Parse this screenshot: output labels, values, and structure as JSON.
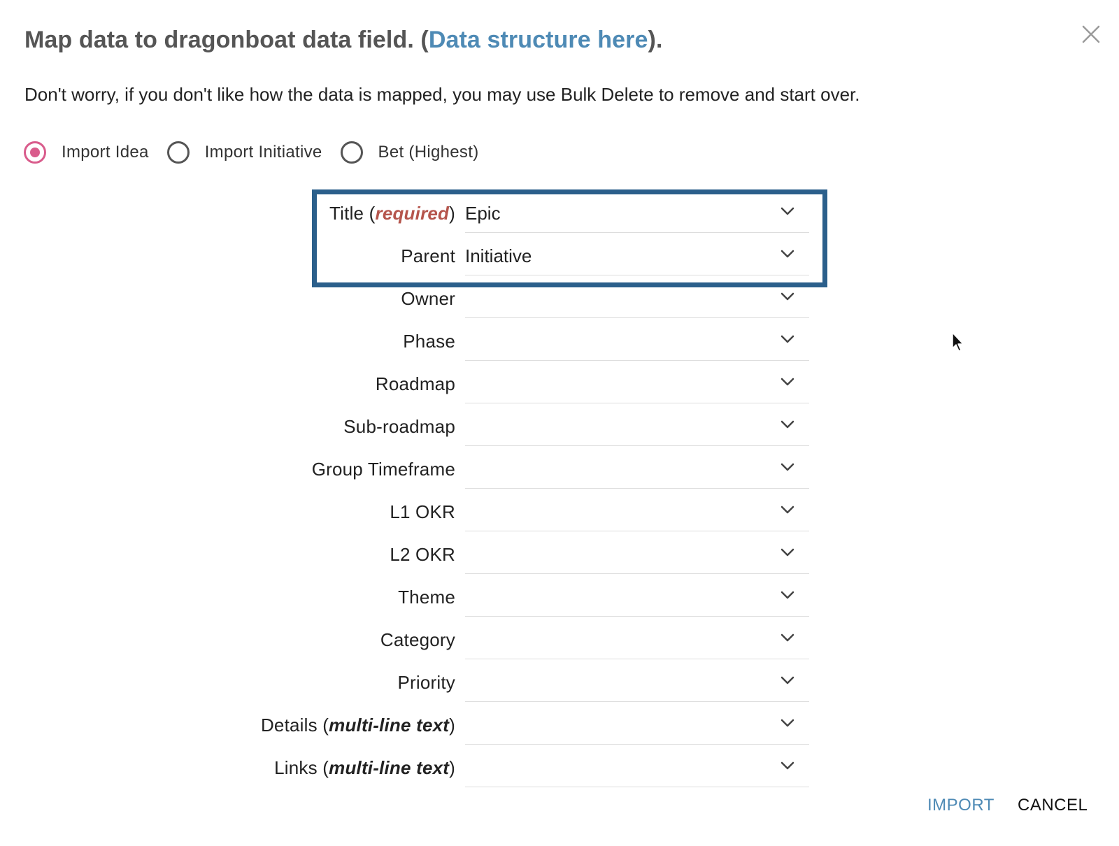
{
  "dialog": {
    "title_prefix": "Map data to dragonboat data field. (",
    "title_link": "Data structure here",
    "title_suffix": ").",
    "subtitle": "Don't worry, if you don't like how the data is mapped, you may use Bulk Delete to remove and start over.",
    "close_icon": "close-icon"
  },
  "import_type": {
    "selected": "Import Idea",
    "options": [
      {
        "label": "Import Idea",
        "checked": true
      },
      {
        "label": "Import Initiative",
        "checked": false
      },
      {
        "label": "Bet (Highest)",
        "checked": false
      }
    ]
  },
  "mappings": [
    {
      "label": "Title",
      "qualifier": "required",
      "value": "Epic"
    },
    {
      "label": "Parent",
      "qualifier": "",
      "value": "Initiative"
    },
    {
      "label": "Owner",
      "qualifier": "",
      "value": ""
    },
    {
      "label": "Phase",
      "qualifier": "",
      "value": ""
    },
    {
      "label": "Roadmap",
      "qualifier": "",
      "value": ""
    },
    {
      "label": "Sub-roadmap",
      "qualifier": "",
      "value": ""
    },
    {
      "label": "Group Timeframe",
      "qualifier": "",
      "value": ""
    },
    {
      "label": "L1 OKR",
      "qualifier": "",
      "value": ""
    },
    {
      "label": "L2 OKR",
      "qualifier": "",
      "value": ""
    },
    {
      "label": "Theme",
      "qualifier": "",
      "value": ""
    },
    {
      "label": "Category",
      "qualifier": "",
      "value": ""
    },
    {
      "label": "Priority",
      "qualifier": "",
      "value": ""
    },
    {
      "label": "Details",
      "qualifier": "multi-line text",
      "value": ""
    },
    {
      "label": "Links",
      "qualifier": "multi-line text",
      "value": ""
    }
  ],
  "footer": {
    "import_label": "IMPORT",
    "cancel_label": "CANCEL"
  },
  "colors": {
    "accent_link": "#4e8ab5",
    "radio_checked": "#d95c8c",
    "required_text": "#b5554c",
    "highlight_border": "#2b5f8b"
  }
}
